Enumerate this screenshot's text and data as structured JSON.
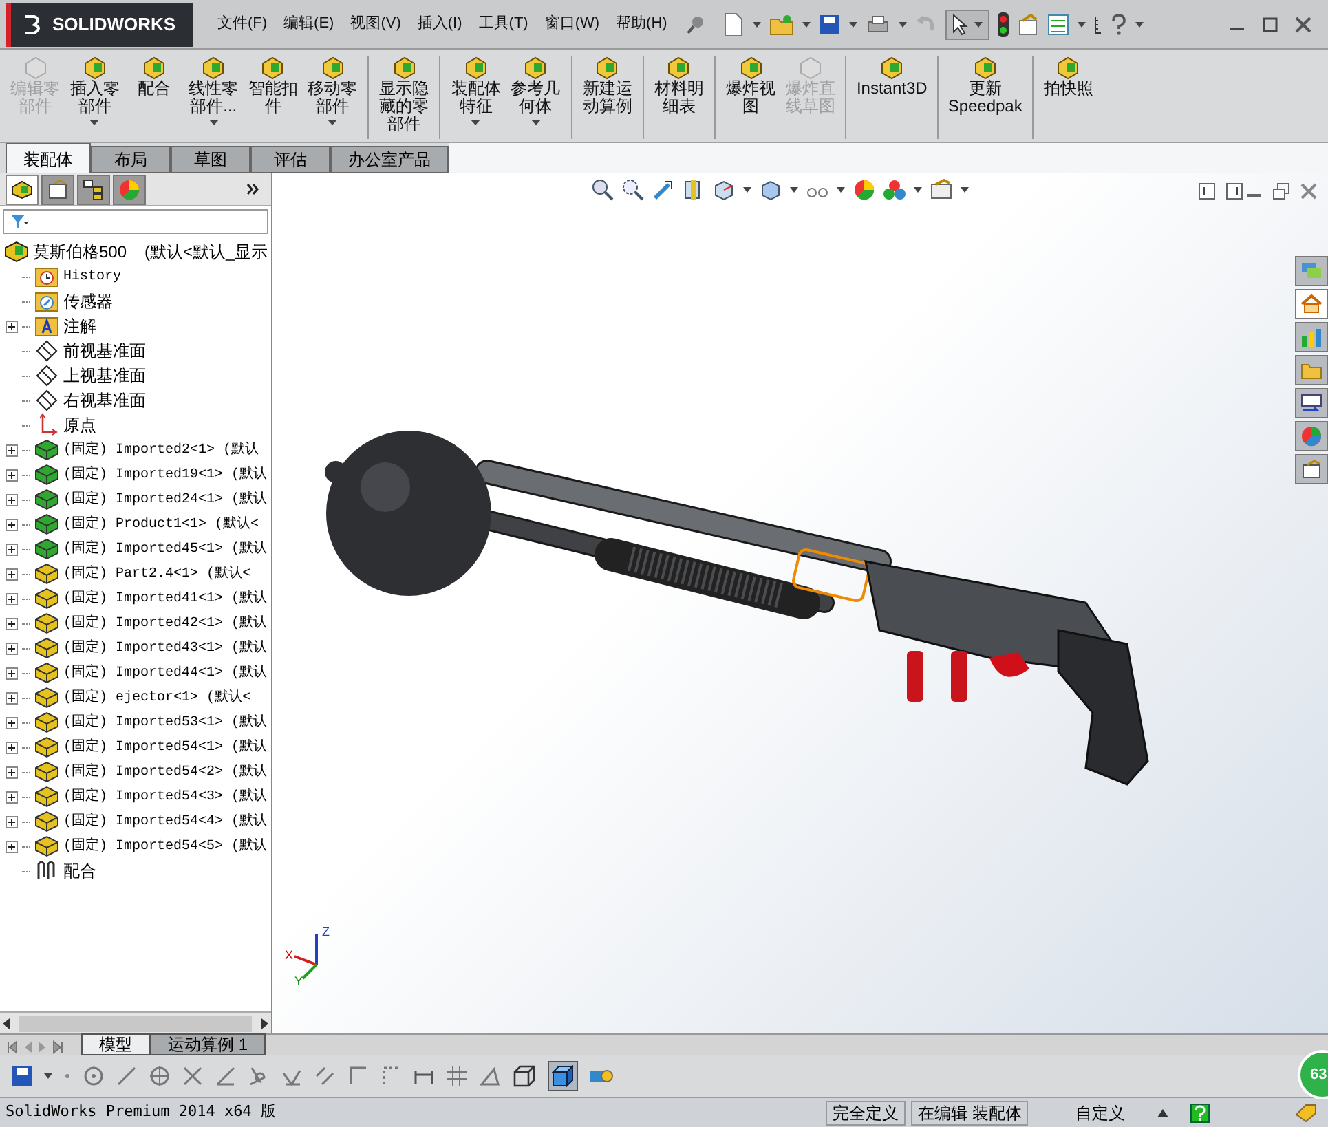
{
  "brand": "SOLIDWORKS",
  "menu": [
    "文件(F)",
    "编辑(E)",
    "视图(V)",
    "插入(I)",
    "工具(T)",
    "窗口(W)",
    "帮助(H)"
  ],
  "toolbar_groups": [
    [
      {
        "label": "编辑零部件",
        "disabled": true,
        "dropdown": false
      },
      {
        "label": "插入零部件",
        "disabled": false,
        "dropdown": true
      },
      {
        "label": "配合",
        "disabled": false,
        "dropdown": false
      },
      {
        "label": "线性零部件...",
        "disabled": false,
        "dropdown": true
      },
      {
        "label": "智能扣件",
        "disabled": false,
        "dropdown": false
      },
      {
        "label": "移动零部件",
        "disabled": false,
        "dropdown": true
      }
    ],
    [
      {
        "label": "显示隐藏的零部件",
        "disabled": false,
        "dropdown": false
      }
    ],
    [
      {
        "label": "装配体特征",
        "disabled": false,
        "dropdown": true
      },
      {
        "label": "参考几何体",
        "disabled": false,
        "dropdown": true
      }
    ],
    [
      {
        "label": "新建运动算例",
        "disabled": false,
        "dropdown": false
      }
    ],
    [
      {
        "label": "材料明细表",
        "disabled": false,
        "dropdown": false
      }
    ],
    [
      {
        "label": "爆炸视图",
        "disabled": false,
        "dropdown": false
      },
      {
        "label": "爆炸直线草图",
        "disabled": true,
        "dropdown": false
      }
    ],
    [
      {
        "label": "Instant3D",
        "disabled": false,
        "dropdown": false
      }
    ],
    [
      {
        "label": "更新 Speedpak",
        "disabled": false,
        "dropdown": false
      }
    ],
    [
      {
        "label": "拍快照",
        "disabled": false,
        "dropdown": false
      }
    ]
  ],
  "command_tabs": [
    {
      "label": "装配体",
      "selected": true
    },
    {
      "label": "布局",
      "selected": false
    },
    {
      "label": "草图",
      "selected": false
    },
    {
      "label": "评估",
      "selected": false
    },
    {
      "label": "办公室产品",
      "selected": false
    }
  ],
  "tree": {
    "root": {
      "name": "莫斯伯格500",
      "suffix": "(默认<默认_显示"
    },
    "items": [
      {
        "kind": "history",
        "label": "History",
        "expandable": false
      },
      {
        "kind": "sensors",
        "label": "传感器",
        "expandable": false
      },
      {
        "kind": "annotations",
        "label": "注解",
        "expandable": true
      },
      {
        "kind": "plane",
        "label": "前视基准面",
        "expandable": false
      },
      {
        "kind": "plane",
        "label": "上视基准面",
        "expandable": false
      },
      {
        "kind": "plane",
        "label": "右视基准面",
        "expandable": false
      },
      {
        "kind": "origin",
        "label": "原点",
        "expandable": false
      },
      {
        "kind": "component",
        "label": "(固定) Imported2<1> (默认",
        "expandable": true,
        "color": "#2fa82f"
      },
      {
        "kind": "component",
        "label": "(固定) Imported19<1> (默认",
        "expandable": true,
        "color": "#2fa82f"
      },
      {
        "kind": "component",
        "label": "(固定) Imported24<1> (默认",
        "expandable": true,
        "color": "#2fa82f"
      },
      {
        "kind": "component",
        "label": "(固定) Product1<1> (默认<",
        "expandable": true,
        "color": "#2fa82f"
      },
      {
        "kind": "component",
        "label": "(固定) Imported45<1> (默认",
        "expandable": true,
        "color": "#2fa82f"
      },
      {
        "kind": "component",
        "label": "(固定) Part2.4<1> (默认<",
        "expandable": true,
        "color": "#e6c21e"
      },
      {
        "kind": "component",
        "label": "(固定) Imported41<1> (默认",
        "expandable": true,
        "color": "#e6c21e"
      },
      {
        "kind": "component",
        "label": "(固定) Imported42<1> (默认",
        "expandable": true,
        "color": "#e6c21e"
      },
      {
        "kind": "component",
        "label": "(固定) Imported43<1> (默认",
        "expandable": true,
        "color": "#e6c21e"
      },
      {
        "kind": "component",
        "label": "(固定) Imported44<1> (默认",
        "expandable": true,
        "color": "#e6c21e"
      },
      {
        "kind": "component",
        "label": "(固定) ejector<1> (默认<",
        "expandable": true,
        "color": "#e6c21e"
      },
      {
        "kind": "component",
        "label": "(固定) Imported53<1> (默认",
        "expandable": true,
        "color": "#e6c21e"
      },
      {
        "kind": "component",
        "label": "(固定) Imported54<1> (默认",
        "expandable": true,
        "color": "#e6c21e"
      },
      {
        "kind": "component",
        "label": "(固定) Imported54<2> (默认",
        "expandable": true,
        "color": "#e6c21e"
      },
      {
        "kind": "component",
        "label": "(固定) Imported54<3> (默认",
        "expandable": true,
        "color": "#e6c21e"
      },
      {
        "kind": "component",
        "label": "(固定) Imported54<4> (默认",
        "expandable": true,
        "color": "#e6c21e"
      },
      {
        "kind": "component",
        "label": "(固定) Imported54<5> (默认",
        "expandable": true,
        "color": "#e6c21e"
      },
      {
        "kind": "mates",
        "label": "配合",
        "expandable": false
      }
    ]
  },
  "triad": [
    "X",
    "Y",
    "Z"
  ],
  "bottom_tabs": [
    {
      "label": "模型",
      "selected": true
    },
    {
      "label": "运动算例 1",
      "selected": false
    }
  ],
  "badge": "63",
  "status_bar": {
    "product": "SolidWorks Premium 2014 x64 版",
    "fields": [
      "完全定义",
      "在编辑 装配体",
      "自定义"
    ]
  }
}
